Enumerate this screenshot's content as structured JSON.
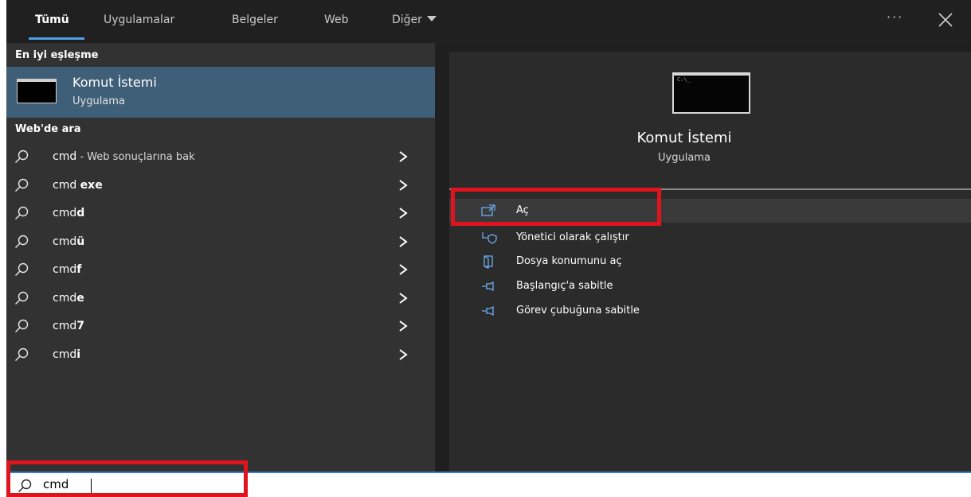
{
  "tabs": [
    {
      "label": "Tümü",
      "active": true
    },
    {
      "label": "Uygulamalar",
      "active": false
    },
    {
      "label": "Belgeler",
      "active": false
    },
    {
      "label": "Web",
      "active": false
    },
    {
      "label": "Diğer",
      "active": false
    }
  ],
  "more_options_label": "···",
  "icons": {
    "search": "search-icon",
    "chevron": "chevron-right-icon",
    "close": "close-icon",
    "open": "open-icon",
    "admin": "run-as-admin-icon",
    "folder": "file-location-icon",
    "pin": "pin-icon"
  },
  "colors": {
    "accent": "#4ea0e8",
    "selected_bg": "#3f5f78",
    "highlight_red": "#e0141e"
  },
  "best_match": {
    "header": "En iyi eşleşme",
    "title": "Komut İstemi",
    "subtitle": "Uygulama"
  },
  "web_search": {
    "header": "Web'de ara",
    "items": [
      {
        "prefix": "cmd",
        "bold": "",
        "muted": " - Web sonuçlarına bak"
      },
      {
        "prefix": "cmd ",
        "bold": "exe",
        "muted": ""
      },
      {
        "prefix": "cmd",
        "bold": "d",
        "muted": ""
      },
      {
        "prefix": "cmd",
        "bold": "ü",
        "muted": ""
      },
      {
        "prefix": "cmd",
        "bold": "f",
        "muted": ""
      },
      {
        "prefix": "cmd",
        "bold": "e",
        "muted": ""
      },
      {
        "prefix": "cmd",
        "bold": "7",
        "muted": ""
      },
      {
        "prefix": "cmd",
        "bold": "i",
        "muted": ""
      }
    ]
  },
  "detail": {
    "title": "Komut İstemi",
    "subtitle": "Uygulama",
    "actions": [
      {
        "label": "Aç"
      },
      {
        "label": "Yönetici olarak çalıştır"
      },
      {
        "label": "Dosya konumunu aç"
      },
      {
        "label": "Başlangıç'a sabitle"
      },
      {
        "label": "Görev çubuğuna sabitle"
      }
    ]
  },
  "search": {
    "value": "cmd"
  }
}
